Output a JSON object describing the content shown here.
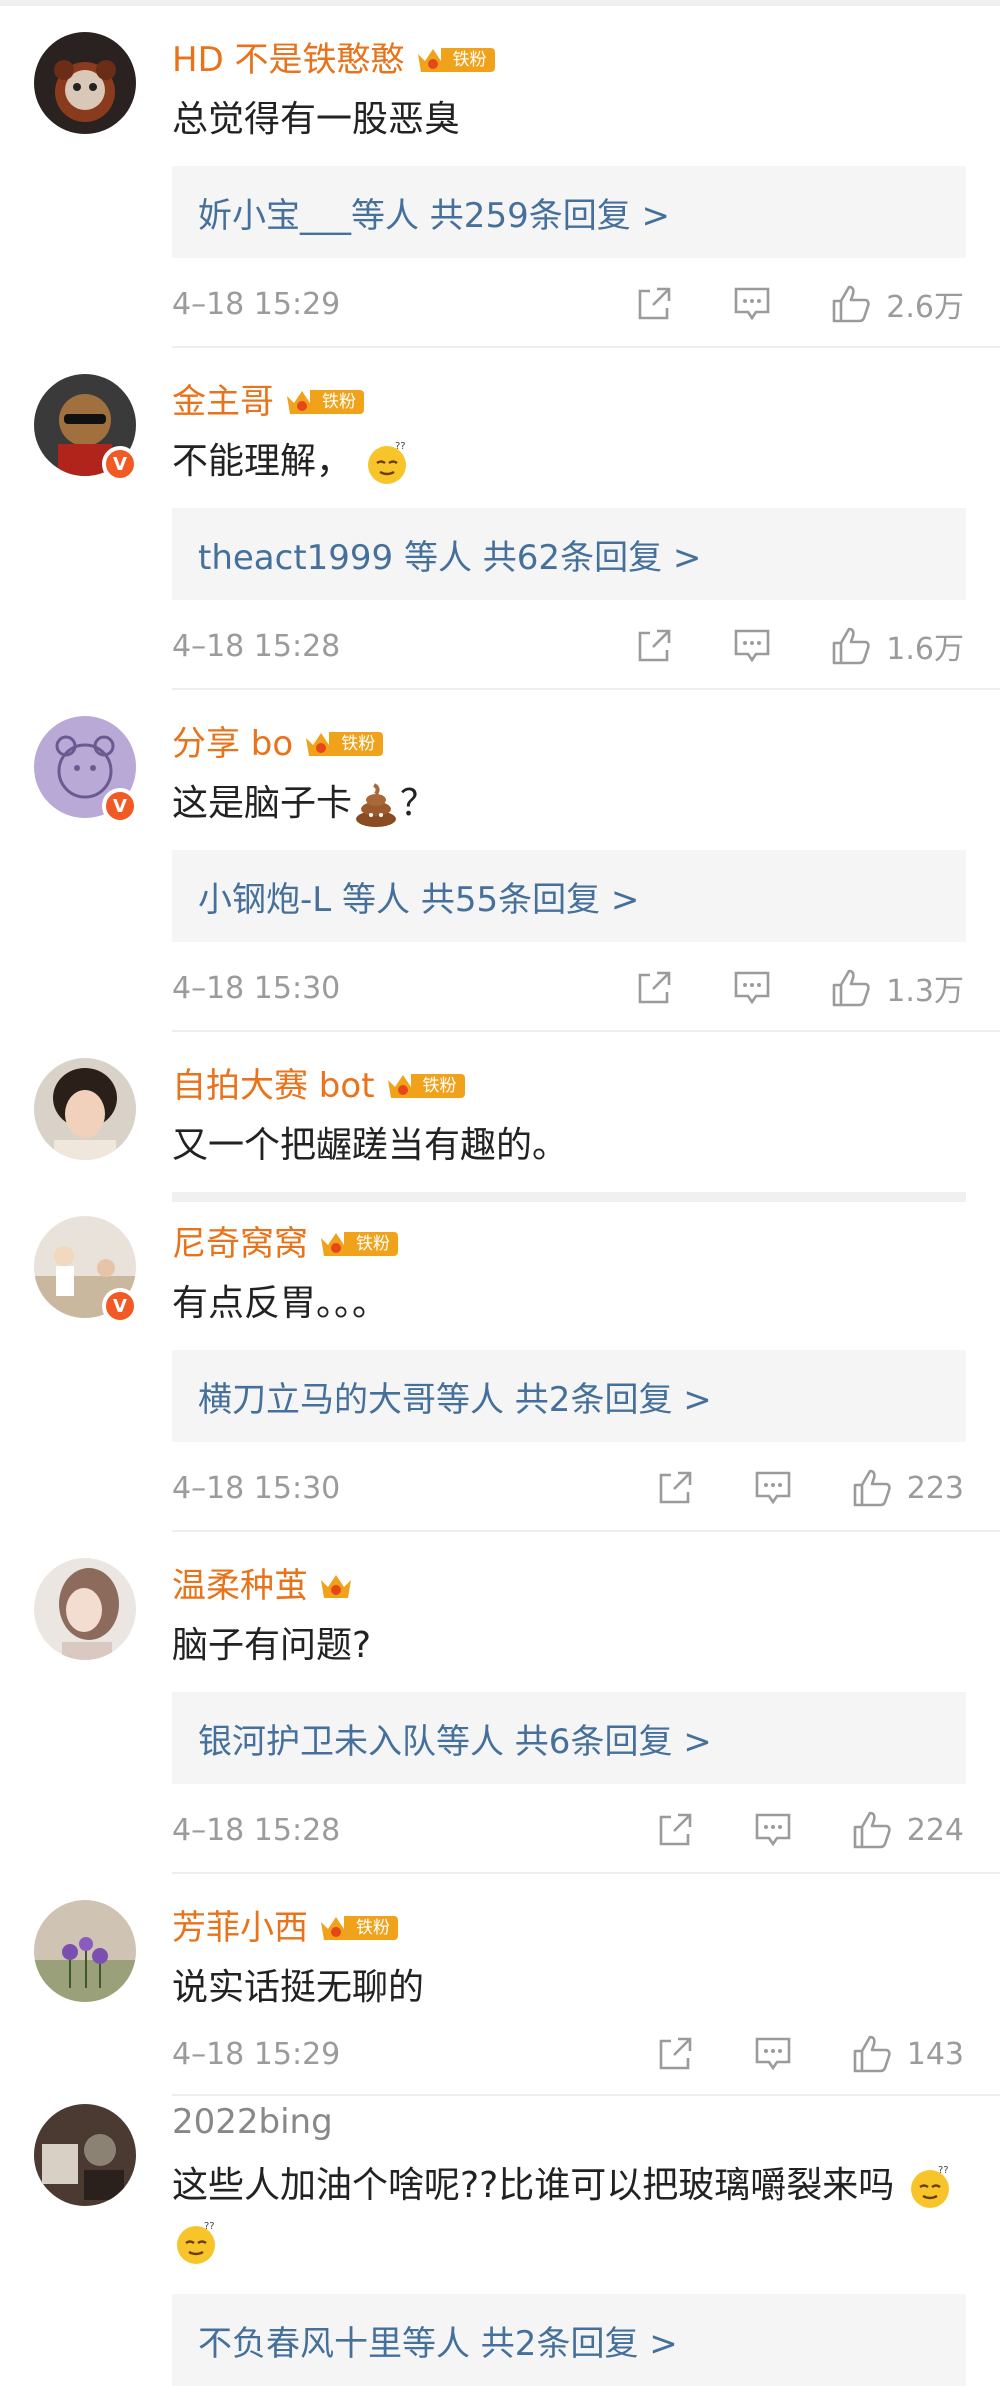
{
  "fan_tag": "铁粉",
  "comments": [
    {
      "name": "HD 不是铁憨憨",
      "fan": true,
      "verified": false,
      "text": "总觉得有一股恶臭",
      "reply": "妡小宝___等人  共259条回复 >",
      "time": "4–18 15:29",
      "likes": "2.6万",
      "avatar": "red-panda"
    },
    {
      "name": "金主哥",
      "fan": true,
      "verified": true,
      "text": "不能理解，",
      "reply": "theact1999 等人  共62条回复 >",
      "time": "4–18 15:28",
      "likes": "1.6万",
      "avatar": "bear-sunglasses"
    },
    {
      "name": "分享 bo",
      "fan": true,
      "verified": true,
      "text": "这是脑子卡",
      "text_suffix": "？",
      "reply": "小钢炮-L 等人  共55条回复 >",
      "time": "4–18 15:30",
      "likes": "1.3万",
      "avatar": "purple-bear"
    },
    {
      "name": "自拍大赛 bot",
      "fan": true,
      "verified": false,
      "text": "又一个把龌蹉当有趣的。",
      "avatar": "girl"
    },
    {
      "name": "尼奇窝窝",
      "fan": true,
      "verified": true,
      "text": "有点反胃。。。",
      "reply": "横刀立马的大哥等人  共2条回复 >",
      "time": "4–18 15:30",
      "likes": "223",
      "avatar": "room"
    },
    {
      "name": "温柔种茧",
      "fan": true,
      "fan_tag_hidden": true,
      "verified": false,
      "text": "脑子有问题?",
      "reply": "银河护卫未入队等人  共6条回复 >",
      "time": "4–18 15:28",
      "likes": "224",
      "avatar": "girl-hair"
    },
    {
      "name": "芳菲小西",
      "fan": true,
      "verified": false,
      "text": "说实话挺无聊的",
      "time": "4–18 15:29",
      "likes": "143",
      "avatar": "flowers"
    },
    {
      "name": "2022bing",
      "fan": false,
      "verified": false,
      "text": "这些人加油个啥呢??比谁可以把玻璃嚼裂来吗",
      "reply": "不负春风十里等人  共2条回复 >",
      "avatar": "dark"
    }
  ],
  "colors": {
    "name": "#e8731a",
    "reply_link": "#45709c",
    "fan_badge": "#f0a21b",
    "verified": "#f15a24",
    "meta": "#9b9b9b"
  },
  "icons": [
    "share-icon",
    "comment-icon",
    "like-icon",
    "crown-icon",
    "sweat-emoji",
    "poop-emoji"
  ]
}
